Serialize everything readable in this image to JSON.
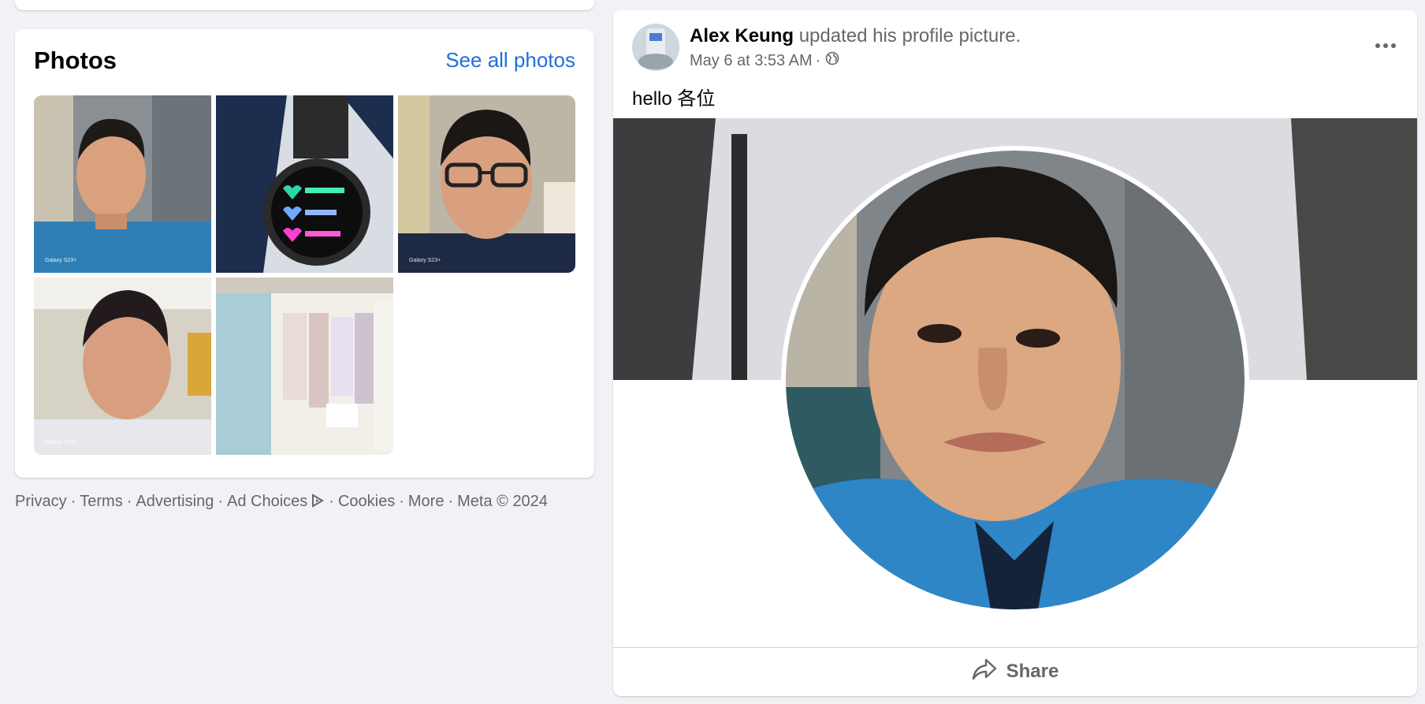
{
  "photos": {
    "title": "Photos",
    "see_all": "See all photos",
    "watermark": "Galaxy S23+"
  },
  "footer": {
    "links": [
      "Privacy",
      "Terms",
      "Advertising",
      "Ad Choices",
      "Cookies",
      "More"
    ],
    "copyright": "Meta © 2024"
  },
  "post": {
    "author": "Alex Keung",
    "action": "updated his profile picture.",
    "time": "May 6 at 3:53 AM",
    "separator": "·",
    "text": "hello 各位",
    "share_label": "Share"
  },
  "colors": {
    "link": "#216fdb",
    "muted": "#65676b",
    "background": "#f0f2f5"
  }
}
